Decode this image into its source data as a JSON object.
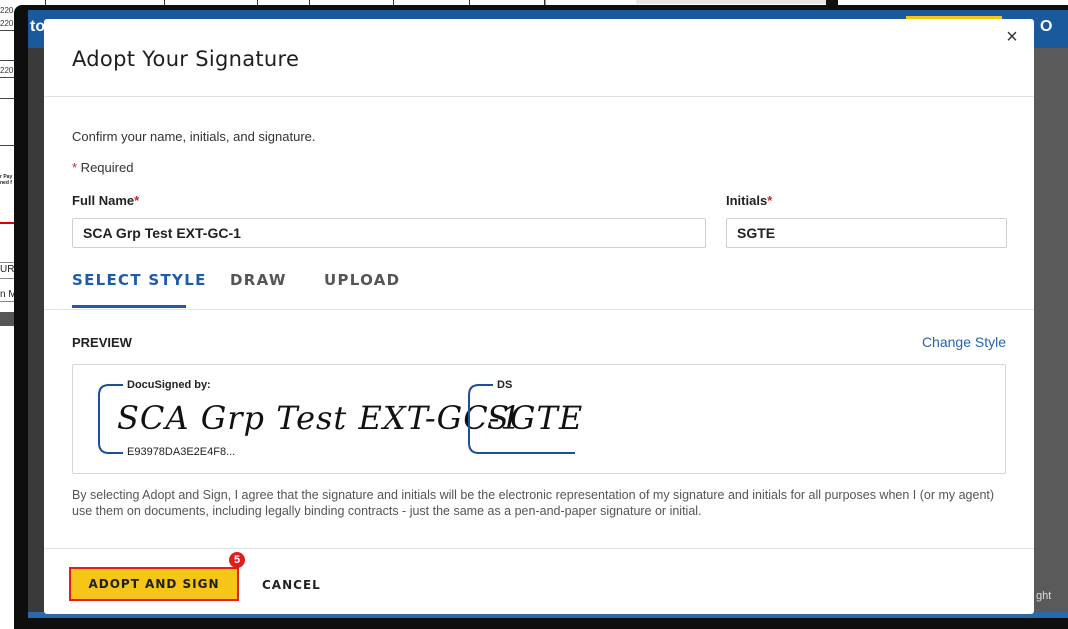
{
  "background": {
    "doc_fragments": [
      "220",
      "220",
      "220",
      "r Pay",
      "ned f",
      "URE",
      "n Ma"
    ],
    "appbar_left_fragment": "to",
    "appbar_right_fragment": "O",
    "copyright_fragment": "ght"
  },
  "modal": {
    "title": "Adopt Your Signature",
    "close_glyph": "×",
    "confirm_text": "Confirm your name, initials, and signature.",
    "required_mark": "*",
    "required_text": " Required",
    "full_name": {
      "label": "Full Name",
      "value": "SCA Grp Test EXT-GC-1"
    },
    "initials": {
      "label": "Initials",
      "value": "SGTE"
    },
    "tabs": [
      {
        "label": "SELECT STYLE",
        "active": true
      },
      {
        "label": "DRAW",
        "active": false
      },
      {
        "label": "UPLOAD",
        "active": false
      }
    ],
    "preview": {
      "label": "PREVIEW",
      "change_style": "Change Style",
      "signature": {
        "header": "DocuSigned by:",
        "script": "SCA Grp Test EXT-GC-1",
        "id": "E93978DA3E2E4F8..."
      },
      "initials_sig": {
        "header": "DS",
        "script": "SGTE"
      }
    },
    "disclaimer": "By selecting Adopt and Sign, I agree that the signature and initials will be the electronic representation of my signature and initials for all purposes when I (or my agent) use them on documents, including legally binding contracts - just the same as a pen-and-paper signature or initial.",
    "adopt_button": "ADOPT AND SIGN",
    "cancel_button": "CANCEL",
    "step_badge": "5"
  },
  "colors": {
    "accent_blue": "#1f5ba8",
    "button_yellow": "#f5c518",
    "highlight_red": "#e01e1e",
    "appbar_blue": "#1a5a9c"
  }
}
